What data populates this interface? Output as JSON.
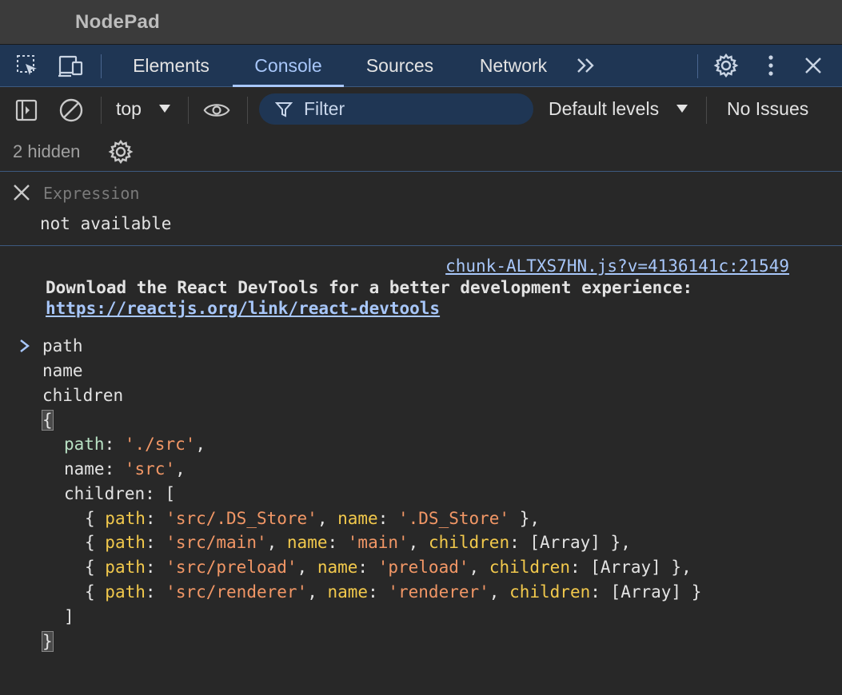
{
  "window": {
    "title": "NodePad"
  },
  "tabs": [
    {
      "label": "Elements",
      "active": false
    },
    {
      "label": "Console",
      "active": true
    },
    {
      "label": "Sources",
      "active": false
    },
    {
      "label": "Network",
      "active": false
    }
  ],
  "tab_overflow": ">>",
  "toolbar": {
    "context": "top",
    "filter_placeholder": "Filter",
    "levels": "Default levels",
    "issues": "No Issues"
  },
  "hidden": {
    "label": "2 hidden"
  },
  "live_expression": {
    "placeholder": "Expression",
    "value": "not available"
  },
  "console": {
    "source_link": "chunk-ALTXS7HN.js?v=4136141c:21549",
    "react_message": "Download the React DevTools for a better development experience:",
    "react_link": "https://reactjs.org/link/react-devtools",
    "output_lines": [
      "path",
      "name",
      "children"
    ],
    "object": {
      "open_brace": "{",
      "close_brace": "}",
      "path_key": "path",
      "path_value": "'./src'",
      "name_key": "name",
      "name_value": "'src'",
      "children_key": "children",
      "children_open": "[",
      "children_close": "]",
      "items": [
        {
          "path": "'src/.DS_Store'",
          "name": "'.DS_Store'",
          "children": null
        },
        {
          "path": "'src/main'",
          "name": "'main'",
          "children": "[Array]"
        },
        {
          "path": "'src/preload'",
          "name": "'preload'",
          "children": "[Array]"
        },
        {
          "path": "'src/renderer'",
          "name": "'renderer'",
          "children": "[Array]"
        }
      ]
    }
  },
  "colors": {
    "accent": "#a8c7fa",
    "tabbar_bg": "#1f3654",
    "string": "#f29766",
    "key": "#f2c94c",
    "background": "#282828"
  },
  "icons": {
    "inspect": "inspect-element-icon",
    "device": "device-toolbar-icon",
    "settings": "gear-icon",
    "menu": "kebab-menu-icon",
    "close": "close-icon",
    "sidebar": "sidebar-toggle-icon",
    "clear": "clear-console-icon",
    "eye": "eye-icon",
    "filter": "filter-icon"
  }
}
